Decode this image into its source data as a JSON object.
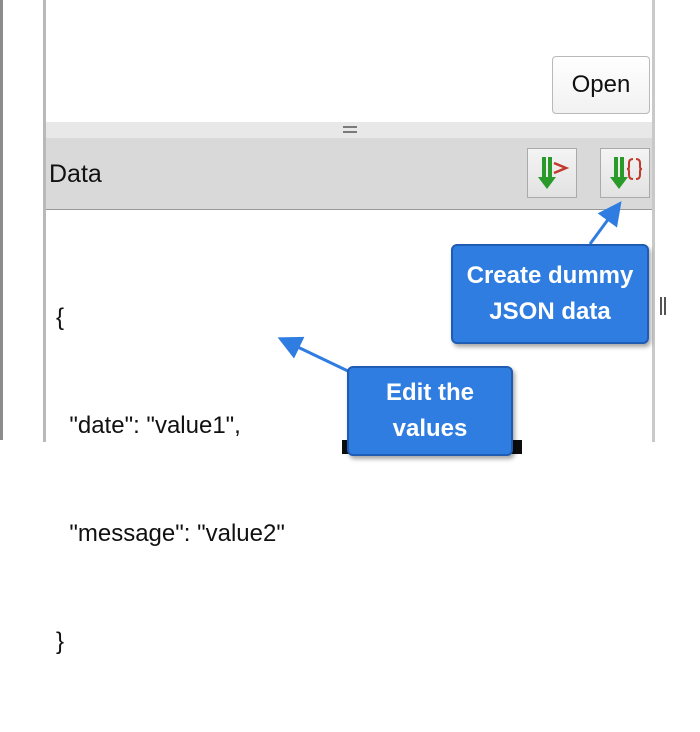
{
  "top_panel": {
    "open_button_label": "Open"
  },
  "data_panel": {
    "title": "Data",
    "toolbar": [
      {
        "icon": "import-arrow-icon"
      },
      {
        "icon": "create-dummy-json-icon"
      }
    ]
  },
  "editor": {
    "lines": [
      "{",
      "  \"date\": \"value1\",",
      "  \"message\": \"value2\"",
      "}"
    ]
  },
  "callouts": {
    "dummy_json": [
      "Create dummy",
      "JSON data"
    ],
    "edit_values": [
      "Edit the",
      "values"
    ]
  },
  "colors": {
    "callout_bg": "#2f7de1",
    "header_bg": "#d9d9d9",
    "arrow": "#2f7de1"
  }
}
